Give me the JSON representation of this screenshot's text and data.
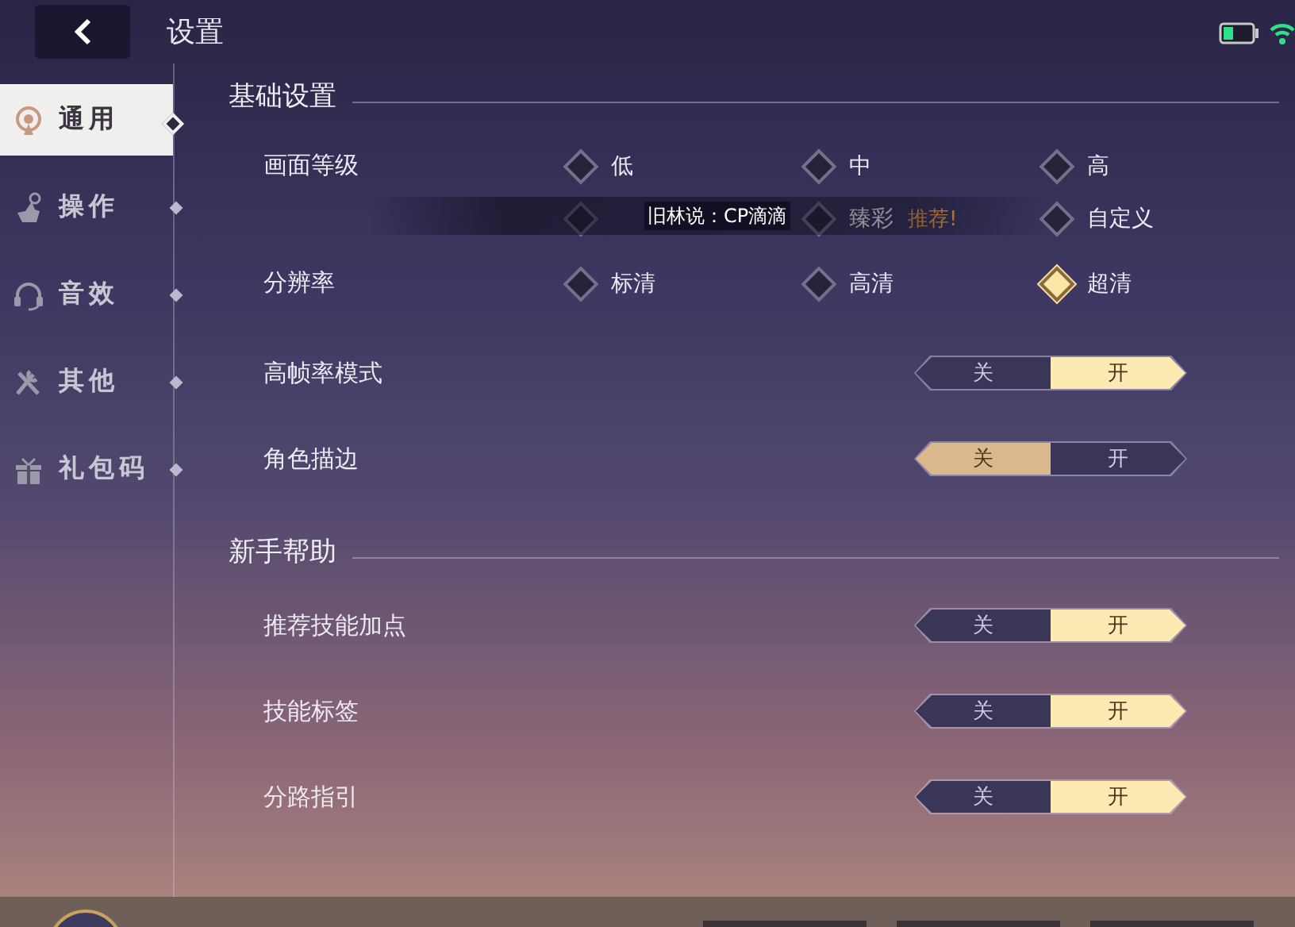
{
  "header": {
    "title": "设置"
  },
  "sidebar": {
    "items": [
      {
        "label": "通用",
        "kind": "signal",
        "selected": true
      },
      {
        "label": "操作",
        "kind": "hand",
        "selected": false
      },
      {
        "label": "音效",
        "kind": "headset",
        "selected": false
      },
      {
        "label": "其他",
        "kind": "tools",
        "selected": false
      },
      {
        "label": "礼包码",
        "kind": "gift",
        "selected": false
      }
    ]
  },
  "sections": [
    {
      "title": "基础设置",
      "rows": [
        {
          "kind": "choice",
          "label": "画面等级",
          "options": [
            {
              "label": "低",
              "selected": false
            },
            {
              "label": "中",
              "selected": false
            },
            {
              "label": "高",
              "selected": false
            },
            {
              "selected": false
            },
            {
              "label": "臻彩",
              "tag": "推荐!",
              "selected": false
            },
            {
              "label": "自定义",
              "selected": false
            }
          ]
        },
        {
          "kind": "choice",
          "label": "分辨率",
          "options": [
            {
              "label": "标清",
              "selected": false
            },
            {
              "label": "高清",
              "selected": false
            },
            {
              "label": "超清",
              "selected": true
            }
          ]
        },
        {
          "kind": "toggle",
          "label": "高帧率模式",
          "off_label": "关",
          "on_label": "开",
          "on": true
        },
        {
          "kind": "toggle",
          "label": "角色描边",
          "off_label": "关",
          "on_label": "开",
          "on": false
        }
      ]
    },
    {
      "title": "新手帮助",
      "rows": [
        {
          "kind": "toggle",
          "label": "推荐技能加点",
          "off_label": "关",
          "on_label": "开",
          "on": true
        },
        {
          "kind": "toggle",
          "label": "技能标签",
          "off_label": "关",
          "on_label": "开",
          "on": true
        },
        {
          "kind": "toggle",
          "label": "分路指引",
          "off_label": "关",
          "on_label": "开",
          "on": true
        }
      ]
    }
  ],
  "chat_overlay": {
    "text": "旧林说：CP滴滴"
  }
}
